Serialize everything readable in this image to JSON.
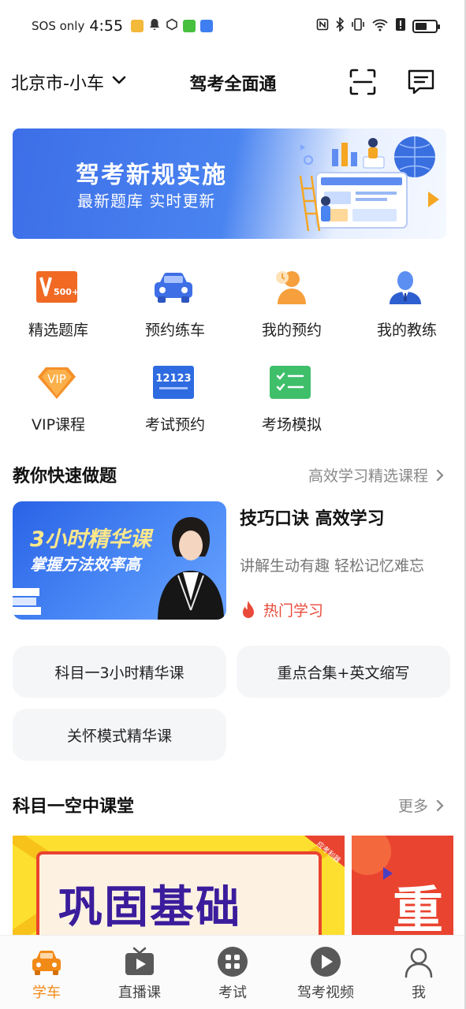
{
  "status_bar": {
    "carrier": "SOS only",
    "time": "4:55",
    "battery_level": 0.6
  },
  "header": {
    "city": "北京市-小车",
    "title": "驾考全面通"
  },
  "banner": {
    "title": "驾考新规实施",
    "subtitle": "最新题库  实时更新",
    "badge": "500+"
  },
  "quick_grid": [
    {
      "label": "精选题库",
      "icon": "question-bank-icon"
    },
    {
      "label": "预约练车",
      "icon": "car-icon"
    },
    {
      "label": "我的预约",
      "icon": "booking-person-icon"
    },
    {
      "label": "我的教练",
      "icon": "coach-icon"
    },
    {
      "label": "VIP课程",
      "icon": "vip-badge-icon"
    },
    {
      "label": "考试预约",
      "icon": "exam-12123-icon"
    },
    {
      "label": "考场模拟",
      "icon": "checklist-icon"
    }
  ],
  "exam_12123": "12123",
  "vip_text": "VIP",
  "section_quick": {
    "title": "教你快速做题",
    "more": "高效学习精选课程"
  },
  "course": {
    "image_line1": "3小时精华课",
    "image_line2": "掌握方法效率高",
    "title": "技巧口诀 高效学习",
    "desc": "讲解生动有趣 轻松记忆难忘",
    "hot": "热门学习"
  },
  "pills": [
    "科目一3小时精华课",
    "重点合集+英文缩写",
    "关怀模式精华课"
  ],
  "section_class": {
    "title": "科目一空中课堂",
    "more": "更多"
  },
  "class_cards": {
    "card1_text": "巩固基础",
    "card1_tag": "应考利器",
    "card2_text": "重"
  },
  "bottom_nav": [
    {
      "label": "学车",
      "icon": "car-icon",
      "active": true
    },
    {
      "label": "直播课",
      "icon": "tv-play-icon",
      "active": false
    },
    {
      "label": "考试",
      "icon": "grid-icon",
      "active": false
    },
    {
      "label": "驾考视频",
      "icon": "play-circle-icon",
      "active": false
    },
    {
      "label": "我",
      "icon": "user-icon",
      "active": false
    }
  ],
  "colors": {
    "accent_orange": "#f28a17",
    "banner_blue": "#3d6ee8",
    "hot_red": "#e94a3a"
  }
}
